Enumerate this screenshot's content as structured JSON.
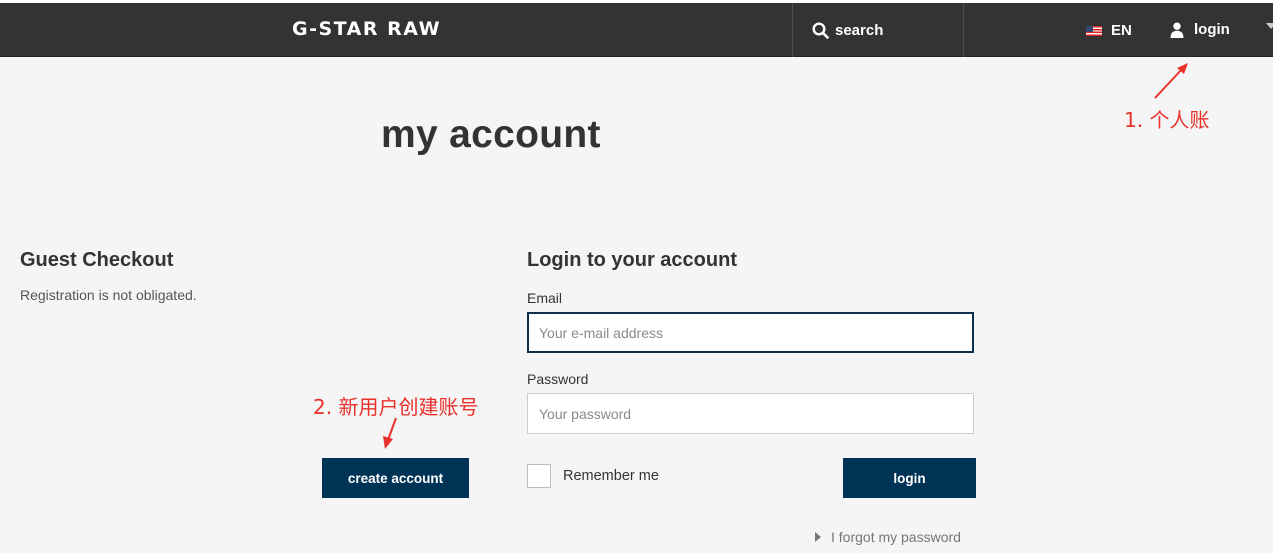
{
  "header": {
    "logo_text": "G-STAR RAW",
    "search_label": "search",
    "language_label": "EN",
    "login_label": "login"
  },
  "annotations": {
    "note_1": "1. 个人账",
    "note_2": "2. 新用户创建账号"
  },
  "page": {
    "title": "my account"
  },
  "guest": {
    "heading": "Guest Checkout",
    "description": "Registration is not obligated.",
    "create_button": "create account"
  },
  "login_form": {
    "heading": "Login to your account",
    "email_label": "Email",
    "email_placeholder": "Your e-mail address",
    "email_value": "",
    "password_label": "Password",
    "password_placeholder": "Your password",
    "password_value": "",
    "remember_label": "Remember me",
    "remember_checked": false,
    "submit_label": "login",
    "forgot_label": "I forgot my password"
  },
  "colors": {
    "header_bg": "#333333",
    "button_navy": "#003457",
    "annotation_red": "#e8312b",
    "page_bg": "#f5f5f5"
  },
  "icons": {
    "search": "search-icon",
    "flag": "us-flag-icon",
    "user": "user-icon",
    "forgot_caret": "caret-right-icon"
  }
}
